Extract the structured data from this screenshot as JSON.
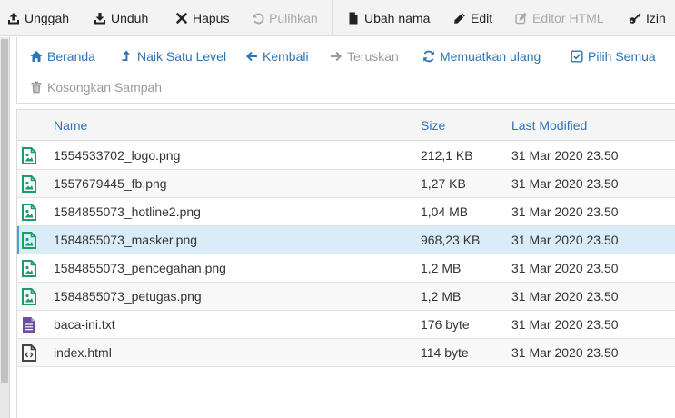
{
  "toolbar": {
    "upload": "Unggah",
    "download": "Unduh",
    "delete": "Hapus",
    "restore": "Pulihkan",
    "rename": "Ubah nama",
    "edit": "Edit",
    "html_editor": "Editor HTML",
    "permissions": "Izin"
  },
  "nav": {
    "home": "Beranda",
    "up_one_level": "Naik Satu Level",
    "back": "Kembali",
    "forward": "Teruskan",
    "reload": "Memuatkan ulang",
    "select_all": "Pilih Semua",
    "empty_trash": "Kosongkan Sampah"
  },
  "table": {
    "headers": {
      "name": "Name",
      "size": "Size",
      "modified": "Last Modified"
    },
    "rows": [
      {
        "name": "1554533702_logo.png",
        "size": "212,1 KB",
        "modified": "31 Mar 2020 23.50",
        "type": "image"
      },
      {
        "name": "1557679445_fb.png",
        "size": "1,27 KB",
        "modified": "31 Mar 2020 23.50",
        "type": "image"
      },
      {
        "name": "1584855073_hotline2.png",
        "size": "1,04 MB",
        "modified": "31 Mar 2020 23.50",
        "type": "image"
      },
      {
        "name": "1584855073_masker.png",
        "size": "968,23 KB",
        "modified": "31 Mar 2020 23.50",
        "type": "image",
        "selected": true
      },
      {
        "name": "1584855073_pencegahan.png",
        "size": "1,2 MB",
        "modified": "31 Mar 2020 23.50",
        "type": "image"
      },
      {
        "name": "1584855073_petugas.png",
        "size": "1,2 MB",
        "modified": "31 Mar 2020 23.50",
        "type": "image"
      },
      {
        "name": "baca-ini.txt",
        "size": "176 byte",
        "modified": "31 Mar 2020 23.50",
        "type": "text"
      },
      {
        "name": "index.html",
        "size": "114 byte",
        "modified": "31 Mar 2020 23.50",
        "type": "code"
      }
    ]
  },
  "colors": {
    "link": "#2f73b7",
    "image_icon": "#1e9b6b",
    "text_icon": "#6c4f9e",
    "code_icon": "#444444",
    "selected_row": "#d9ecf7"
  },
  "icons": {
    "upload": "upload-icon",
    "download": "download-icon",
    "delete": "close-icon",
    "restore": "undo-icon",
    "rename": "file-icon",
    "edit": "pencil-icon",
    "html_editor": "edit-square-icon",
    "permissions": "key-icon",
    "home": "home-icon",
    "up_one_level": "level-up-icon",
    "back": "arrow-left-icon",
    "forward": "arrow-right-icon",
    "reload": "refresh-icon",
    "select_all": "check-square-icon",
    "empty_trash": "trash-icon"
  }
}
